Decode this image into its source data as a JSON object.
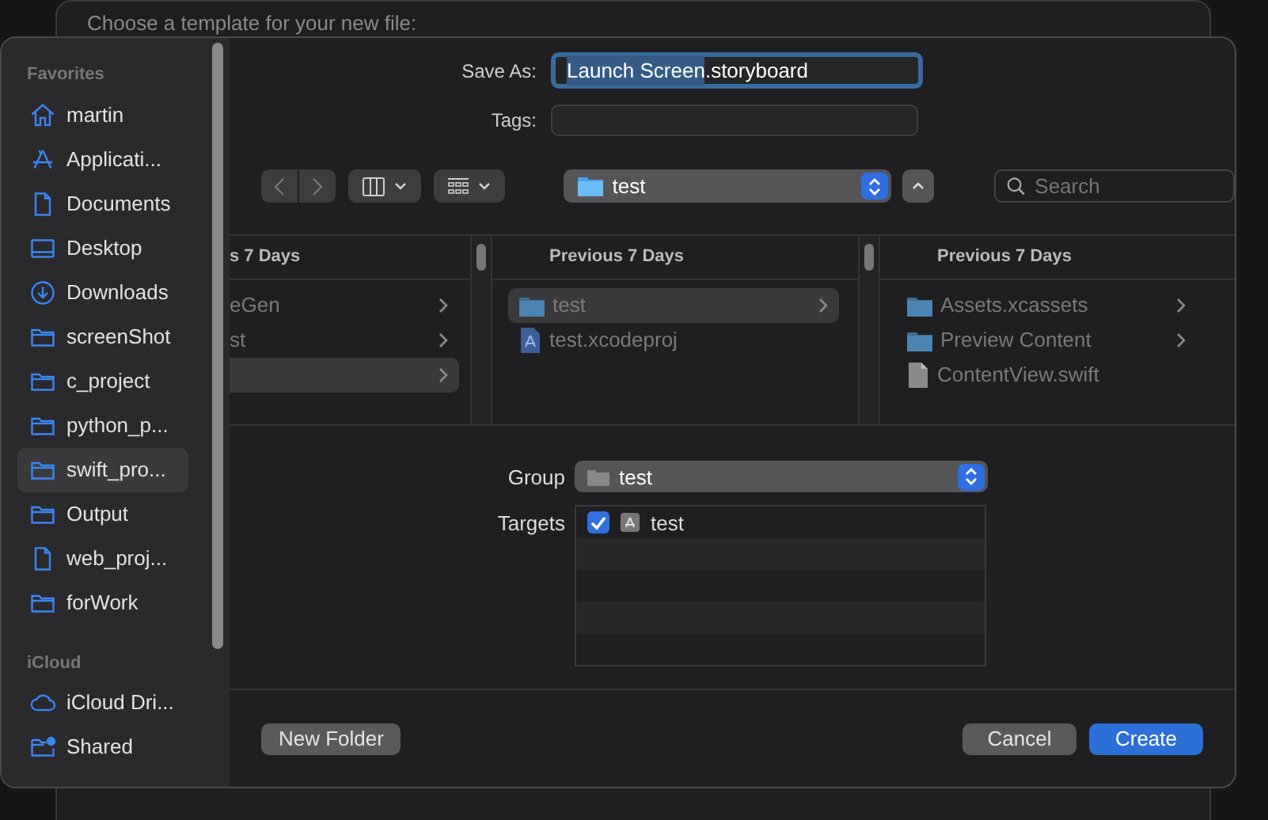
{
  "background_window": {
    "title": "Choose a template for your new file:"
  },
  "sidebar": {
    "sections": [
      {
        "heading": "Favorites",
        "items": [
          {
            "label": "martin",
            "kind": "home",
            "selected": false
          },
          {
            "label": "Applicati...",
            "kind": "apps",
            "selected": false
          },
          {
            "label": "Documents",
            "kind": "doc",
            "selected": false
          },
          {
            "label": "Desktop",
            "kind": "desktop",
            "selected": false
          },
          {
            "label": "Downloads",
            "kind": "download",
            "selected": false
          },
          {
            "label": "screenShot",
            "kind": "folder",
            "selected": false
          },
          {
            "label": "c_project",
            "kind": "folder",
            "selected": false
          },
          {
            "label": "python_p...",
            "kind": "folder",
            "selected": false
          },
          {
            "label": "swift_pro...",
            "kind": "folder",
            "selected": true
          },
          {
            "label": "Output",
            "kind": "folder",
            "selected": false
          },
          {
            "label": "web_proj...",
            "kind": "doc",
            "selected": false
          },
          {
            "label": "forWork",
            "kind": "folder",
            "selected": false
          }
        ]
      },
      {
        "heading": "iCloud",
        "items": [
          {
            "label": "iCloud Dri...",
            "kind": "cloud",
            "selected": false
          },
          {
            "label": "Shared",
            "kind": "shared",
            "selected": false
          }
        ]
      }
    ]
  },
  "save_as": {
    "label": "Save As:",
    "value_parts": [
      {
        "text": "Launch Screen",
        "selected": true
      },
      {
        "text": ".storyboard",
        "selected": false
      }
    ]
  },
  "tags": {
    "label": "Tags:"
  },
  "toolbar": {
    "location": "test",
    "search": {
      "placeholder": "Search"
    }
  },
  "browser": {
    "columns": [
      {
        "header": "s 7 Days",
        "items": [
          {
            "label": "eGen",
            "has_children": true,
            "selected": false
          },
          {
            "label": "st",
            "has_children": true,
            "selected": false
          },
          {
            "has_children": true,
            "selected": true
          }
        ]
      },
      {
        "header": "Previous 7 Days",
        "items": [
          {
            "label": "test",
            "kind": "folder",
            "has_children": true,
            "selected": true
          },
          {
            "label": "test.xcodeproj",
            "kind": "project",
            "has_children": false,
            "selected": false
          }
        ]
      },
      {
        "header": "Previous 7 Days",
        "items": [
          {
            "label": "Assets.xcassets",
            "kind": "folder",
            "has_children": true,
            "selected": false
          },
          {
            "label": "Preview Content",
            "kind": "folder",
            "has_children": true,
            "selected": false
          },
          {
            "label": "ContentView.swift",
            "kind": "file",
            "has_children": false,
            "selected": false
          }
        ]
      }
    ]
  },
  "group": {
    "label": "Group",
    "value": "test"
  },
  "targets": {
    "label": "Targets",
    "rows": [
      {
        "label": "test",
        "checked": true
      }
    ]
  },
  "buttons": [
    {
      "label": "New Folder",
      "kind": "secondary"
    },
    {
      "label": "Cancel",
      "kind": "secondary"
    },
    {
      "label": "Create",
      "kind": "primary"
    }
  ]
}
